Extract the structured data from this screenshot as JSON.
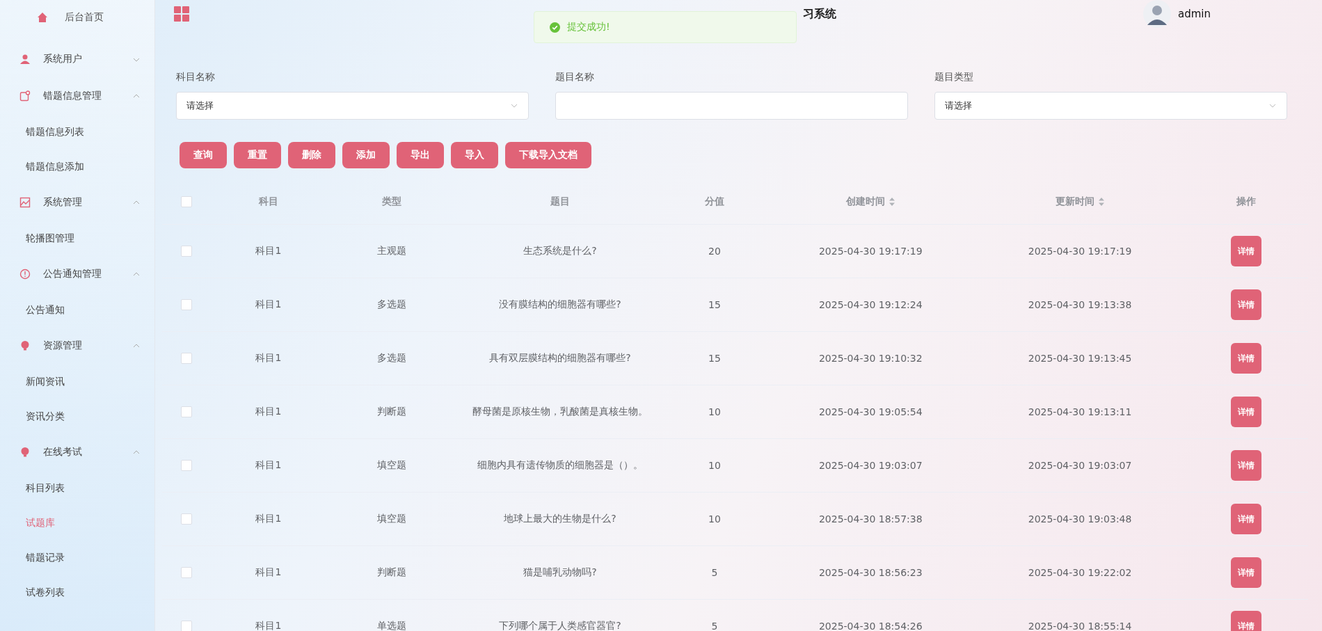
{
  "header": {
    "title": "习系统",
    "user": "admin"
  },
  "toast": {
    "text": "提交成功!"
  },
  "sidebar": {
    "items": [
      {
        "label": "后台首页",
        "kind": "home"
      },
      {
        "label": "系统用户",
        "kind": "group",
        "expanded": false
      },
      {
        "label": "错题信息管理",
        "kind": "group",
        "expanded": true,
        "children": [
          {
            "label": "错题信息列表",
            "selected": false
          },
          {
            "label": "错题信息添加",
            "selected": false
          }
        ]
      },
      {
        "label": "系统管理",
        "kind": "group",
        "expanded": true,
        "children": [
          {
            "label": "轮播图管理",
            "selected": false
          }
        ]
      },
      {
        "label": "公告通知管理",
        "kind": "group",
        "expanded": true,
        "children": [
          {
            "label": "公告通知",
            "selected": false
          }
        ]
      },
      {
        "label": "资源管理",
        "kind": "group",
        "expanded": true,
        "children": [
          {
            "label": "新闻资讯",
            "selected": false
          },
          {
            "label": "资讯分类",
            "selected": false
          }
        ]
      },
      {
        "label": "在线考试",
        "kind": "group",
        "expanded": true,
        "children": [
          {
            "label": "科目列表",
            "selected": false
          },
          {
            "label": "试题库",
            "selected": true
          },
          {
            "label": "错题记录",
            "selected": false
          },
          {
            "label": "试卷列表",
            "selected": false
          }
        ]
      }
    ]
  },
  "filters": [
    {
      "label": "科目名称",
      "kind": "select",
      "placeholder": "请选择"
    },
    {
      "label": "题目名称",
      "kind": "text"
    },
    {
      "label": "题目类型",
      "kind": "select",
      "placeholder": "请选择"
    }
  ],
  "buttons": [
    "查询",
    "重置",
    "删除",
    "添加",
    "导出",
    "导入",
    "下载导入文档"
  ],
  "table": {
    "select_all": false,
    "columns": [
      {
        "label": "科目",
        "sortable": false
      },
      {
        "label": "类型",
        "sortable": false
      },
      {
        "label": "题目",
        "sortable": false
      },
      {
        "label": "分值",
        "sortable": false
      },
      {
        "label": "创建时间",
        "sortable": true
      },
      {
        "label": "更新时间",
        "sortable": true
      },
      {
        "label": "操作",
        "sortable": false
      }
    ],
    "rows": [
      {
        "checked": false,
        "cells": [
          "科目1",
          "主观题",
          "生态系统是什么?",
          "20",
          "2025-04-30 19:17:19",
          "2025-04-30 19:17:19"
        ],
        "action": "详情"
      },
      {
        "checked": false,
        "cells": [
          "科目1",
          "多选题",
          "没有膜结构的细胞器有哪些?",
          "15",
          "2025-04-30 19:12:24",
          "2025-04-30 19:13:38"
        ],
        "action": "详情"
      },
      {
        "checked": false,
        "cells": [
          "科目1",
          "多选题",
          "具有双层膜结构的细胞器有哪些?",
          "15",
          "2025-04-30 19:10:32",
          "2025-04-30 19:13:45"
        ],
        "action": "详情"
      },
      {
        "checked": false,
        "cells": [
          "科目1",
          "判断题",
          "酵母菌是原核生物，乳酸菌是真核生物。",
          "10",
          "2025-04-30 19:05:54",
          "2025-04-30 19:13:11"
        ],
        "action": "详情"
      },
      {
        "checked": false,
        "cells": [
          "科目1",
          "填空题",
          "细胞内具有遗传物质的细胞器是（）。",
          "10",
          "2025-04-30 19:03:07",
          "2025-04-30 19:03:07"
        ],
        "action": "详情"
      },
      {
        "checked": false,
        "cells": [
          "科目1",
          "填空题",
          "地球上最大的生物是什么?",
          "10",
          "2025-04-30 18:57:38",
          "2025-04-30 19:03:48"
        ],
        "action": "详情"
      },
      {
        "checked": false,
        "cells": [
          "科目1",
          "判断题",
          "猫是哺乳动物吗?",
          "5",
          "2025-04-30 18:56:23",
          "2025-04-30 19:22:02"
        ],
        "action": "详情"
      },
      {
        "checked": false,
        "cells": [
          "科目1",
          "单选题",
          "下列哪个属于人类感官器官?",
          "5",
          "2025-04-30 18:54:26",
          "2025-04-30 18:55:14"
        ],
        "action": "详情"
      }
    ]
  }
}
